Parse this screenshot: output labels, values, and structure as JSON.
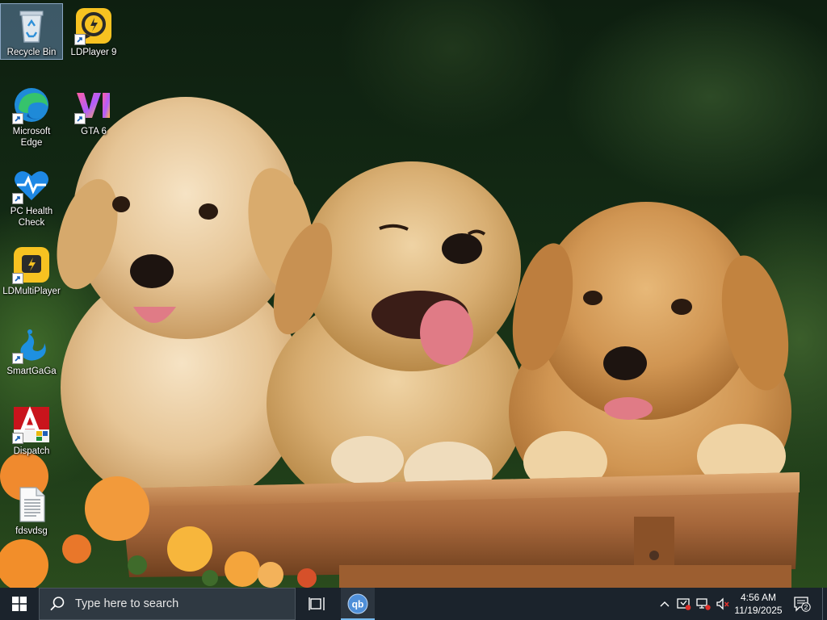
{
  "desktop": {
    "icons": [
      {
        "label": "Recycle Bin",
        "icon": "recycle-bin-icon"
      },
      {
        "label": "LDPlayer 9",
        "icon": "ldplayer-icon"
      },
      {
        "label": "Microsoft Edge",
        "icon": "edge-icon"
      },
      {
        "label": "GTA 6",
        "icon": "gta6-icon"
      },
      {
        "label": "PC Health Check",
        "icon": "pc-health-check-icon"
      },
      {
        "label": "LDMultiPlayer",
        "icon": "ldmultiplayer-icon"
      },
      {
        "label": "SmartGaGa",
        "icon": "smartgaga-icon"
      },
      {
        "label": "Dispatch",
        "icon": "dispatch-icon"
      },
      {
        "label": "fdsvdsg",
        "icon": "text-file-icon"
      }
    ],
    "wallpaper": "three golden retriever puppies in a wooden cart"
  },
  "taskbar": {
    "search_placeholder": "Type here to search",
    "clock_time": "4:56 AM",
    "clock_date": "11/19/2025",
    "notification_count": "2",
    "accent": "#76b9ed",
    "pinned": [
      {
        "label": "qBittorrent",
        "icon": "qbittorrent-icon"
      }
    ]
  }
}
